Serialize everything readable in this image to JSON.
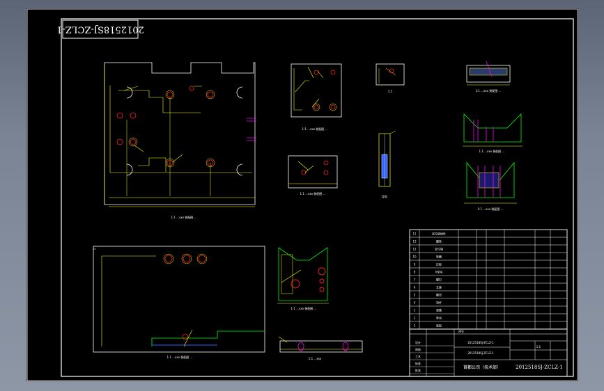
{
  "drawing": {
    "number": "2012518SJ-ZCLZ-1",
    "stamp_number": "2012518SJ-ZCLZ-1",
    "company": "首都公司（技术部）",
    "main_label": "2012518SJ-ZCLZ-1",
    "drawing_no_label": "2012518SJ-ZCLZ-1"
  },
  "views": {
    "plate_top": "1:1 ...xxx 装配图 ...",
    "plate_bottom": "1:1 ...xxx 装配图 ...",
    "small_a": "1:1 ...xxx 装配图 ...",
    "small_b": "1:1 ...xxx 装配图 ...",
    "small_c": "1:1",
    "rail": "导轨",
    "right_a": "1:1 ...xxx 装配图 ...",
    "right_b": "1:1 ...xxx 装配图 ...",
    "right_c": "1:1 ...xxx 装配图 ...",
    "vblock": "1:1 ...xxx 装配图 ...",
    "slot": "1:1 ...xxx"
  },
  "bom": [
    {
      "no": "11",
      "name": "定位销组件"
    },
    {
      "no": "13",
      "name": "螺栓"
    },
    {
      "no": "12",
      "name": "定位销"
    },
    {
      "no": "10",
      "name": "垫圈"
    },
    {
      "no": "9",
      "name": "压板"
    },
    {
      "no": "8",
      "name": "V型块"
    },
    {
      "no": "7",
      "name": "螺钉"
    },
    {
      "no": "6",
      "name": "支座"
    },
    {
      "no": "5",
      "name": "螺母"
    },
    {
      "no": "4",
      "name": "顶杆"
    },
    {
      "no": "3",
      "name": "弹簧"
    },
    {
      "no": "2",
      "name": "垫块"
    },
    {
      "no": "1",
      "name": "底板"
    }
  ],
  "title_block": {
    "headers": [
      "序号",
      "名 称 及 规 格",
      "数量",
      "材 料",
      "备 注"
    ],
    "roles": [
      "设计",
      "审核",
      "工艺",
      "标准",
      "批准"
    ],
    "scale": "1:1"
  },
  "colors": {
    "yellow": "#ffff00",
    "green": "#00ff00",
    "white": "#ffffff",
    "red": "#ff2020",
    "magenta": "#ff00ff",
    "cyan": "#00ffff",
    "blue": "#3060ff"
  }
}
